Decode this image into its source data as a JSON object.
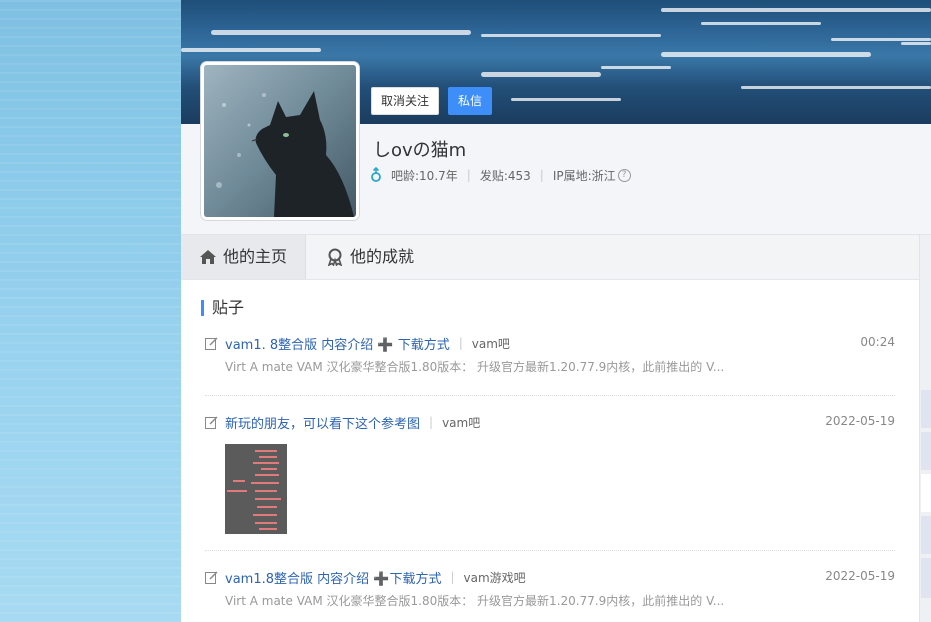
{
  "profile": {
    "username": "しovの猫m",
    "follow_button": "取消关注",
    "message_button": "私信",
    "age_label": "吧龄:10.7年",
    "posts_label": "发贴:453",
    "ip_label": "IP属地:浙江",
    "help_glyph": "?"
  },
  "tabs": {
    "home": "他的主页",
    "achievements": "他的成就"
  },
  "section": {
    "title": "贴子"
  },
  "posts": [
    {
      "title": "vam1. 8整合版 内容介绍 ➕ 下载方式",
      "forum": "vam吧",
      "time": "00:24",
      "abstract": "Virt A mate VAM 汉化豪华整合版1.80版本： 升级官方最新1.20.77.9内核，此前推出的 V..."
    },
    {
      "title": "新玩的朋友，可以看下这个参考图",
      "forum": "vam吧",
      "time": "2022-05-19"
    },
    {
      "title": "vam1.8整合版 内容介绍 ➕下载方式",
      "forum": "vam游戏吧",
      "time": "2022-05-19",
      "abstract": "Virt A mate VAM 汉化豪华整合版1.80版本： 升级官方最新1.20.77.9内核，此前推出的 V..."
    }
  ],
  "colors": {
    "accent": "#3d8ef8",
    "link": "#2d64b3",
    "gender_icon": "#2aa7c9"
  },
  "icons": [
    "home-icon",
    "achievement-icon",
    "edit-icon",
    "gender-male-icon",
    "help-icon"
  ]
}
